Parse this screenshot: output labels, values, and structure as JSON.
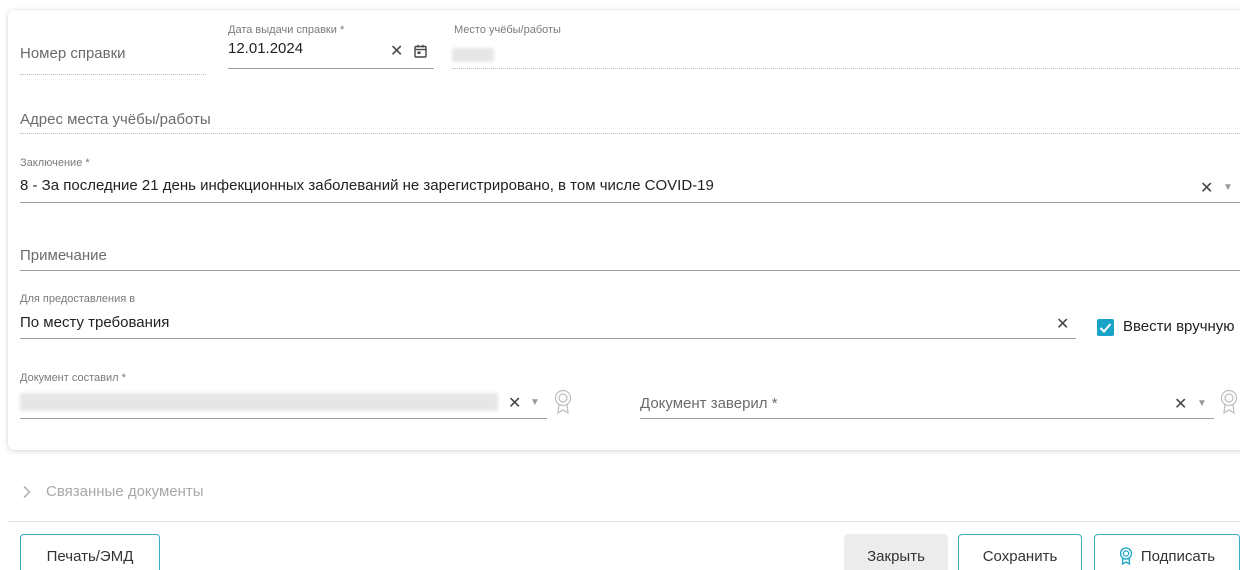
{
  "form": {
    "cert_number": {
      "placeholder": "Номер справки"
    },
    "issue_date": {
      "label": "Дата выдачи справки *",
      "value": "12.01.2024"
    },
    "study_place": {
      "label": "Место учёбы/работы"
    },
    "study_address": {
      "placeholder": "Адрес места учёбы/работы"
    },
    "conclusion": {
      "label": "Заключение *",
      "value": "8 - За последние 21 день инфекционных заболеваний не зарегистрировано, в том числе COVID-19"
    },
    "note": {
      "placeholder": "Примечание"
    },
    "provide_to": {
      "label": "Для предоставления в",
      "value": "По месту требования"
    },
    "manual_input": {
      "label": "Ввести вручную",
      "checked": true
    },
    "composed_by": {
      "label": "Документ составил *"
    },
    "certified_by": {
      "placeholder": "Документ заверил *"
    }
  },
  "related_docs": {
    "label": "Связанные документы"
  },
  "footer": {
    "print_label": "Печать/ЭМД",
    "close_label": "Закрыть",
    "save_label": "Сохранить",
    "sign_label": "Подписать"
  },
  "colors": {
    "accent": "#1aa3c8",
    "button_border": "#3aa7c5"
  },
  "icons": [
    "clear-icon",
    "calendar-icon",
    "dropdown-arrow-icon",
    "signature-seal-icon",
    "chevron-right-icon",
    "checkmark-icon"
  ]
}
